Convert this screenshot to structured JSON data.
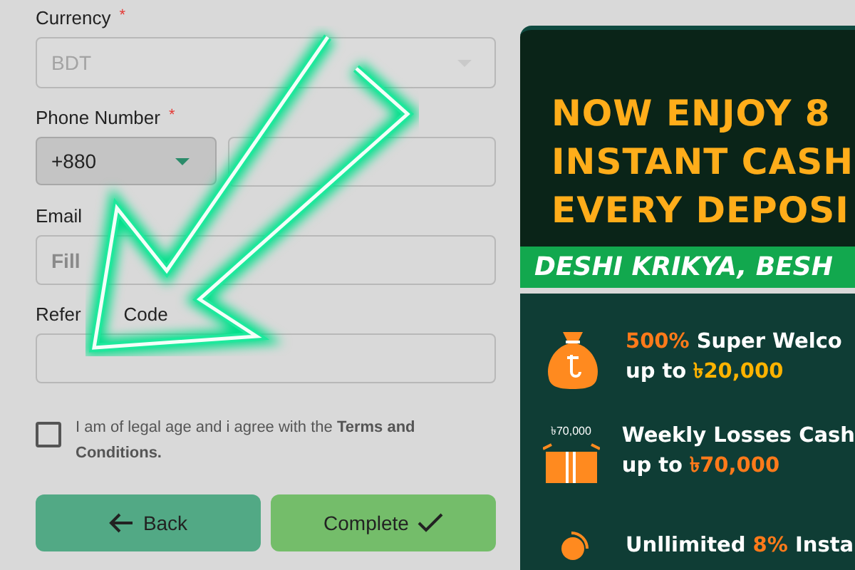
{
  "form": {
    "fields": [
      {
        "kind": "select",
        "label": "Currency",
        "required_mark": "*",
        "value": "BDT",
        "disabled": true
      },
      {
        "kind": "phone",
        "label": "Phone Number",
        "required_mark": "*",
        "code": "+880"
      },
      {
        "kind": "text",
        "label": "Email",
        "placeholder": "Fill"
      },
      {
        "kind": "text",
        "label": "Refer",
        "label_tail": "Code"
      }
    ],
    "agreement": {
      "checked": false,
      "text": "I am of legal age and i agree with the **Terms and Conditions.**"
    },
    "buttons": [
      {
        "kind": "back",
        "label": "Back"
      },
      {
        "kind": "complete",
        "label": "Complete"
      }
    ]
  },
  "promo": {
    "headline": [
      "NOW ENJOY 8",
      "INSTANT CASH",
      "EVERY DEPOSI"
    ],
    "ribbon": "DESHI KRIKYA, BESH",
    "offers": [
      {
        "line1": [
          {
            "text": "500%",
            "color": "#ff7a1a"
          },
          {
            "text": "Super Welco",
            "color": "#ffffff"
          }
        ],
        "line2": [
          {
            "text": "up to",
            "color": "#ffffff"
          },
          {
            "text": "৳20,000",
            "color": "#ffb300"
          }
        ]
      },
      {
        "badge": "৳70,000",
        "line1": [
          {
            "text": "Weekly Losses Cash",
            "color": "#ffffff"
          }
        ],
        "line2": [
          {
            "text": "up to",
            "color": "#ffffff"
          },
          {
            "text": "৳70,000",
            "color": "#ff7a1a"
          }
        ]
      },
      {
        "line1": [
          {
            "text": "Unllimited",
            "color": "#ffffff"
          },
          {
            "text": "8%",
            "color": "#ff7a1a"
          },
          {
            "text": "Insta",
            "color": "#ffffff"
          }
        ]
      }
    ]
  }
}
